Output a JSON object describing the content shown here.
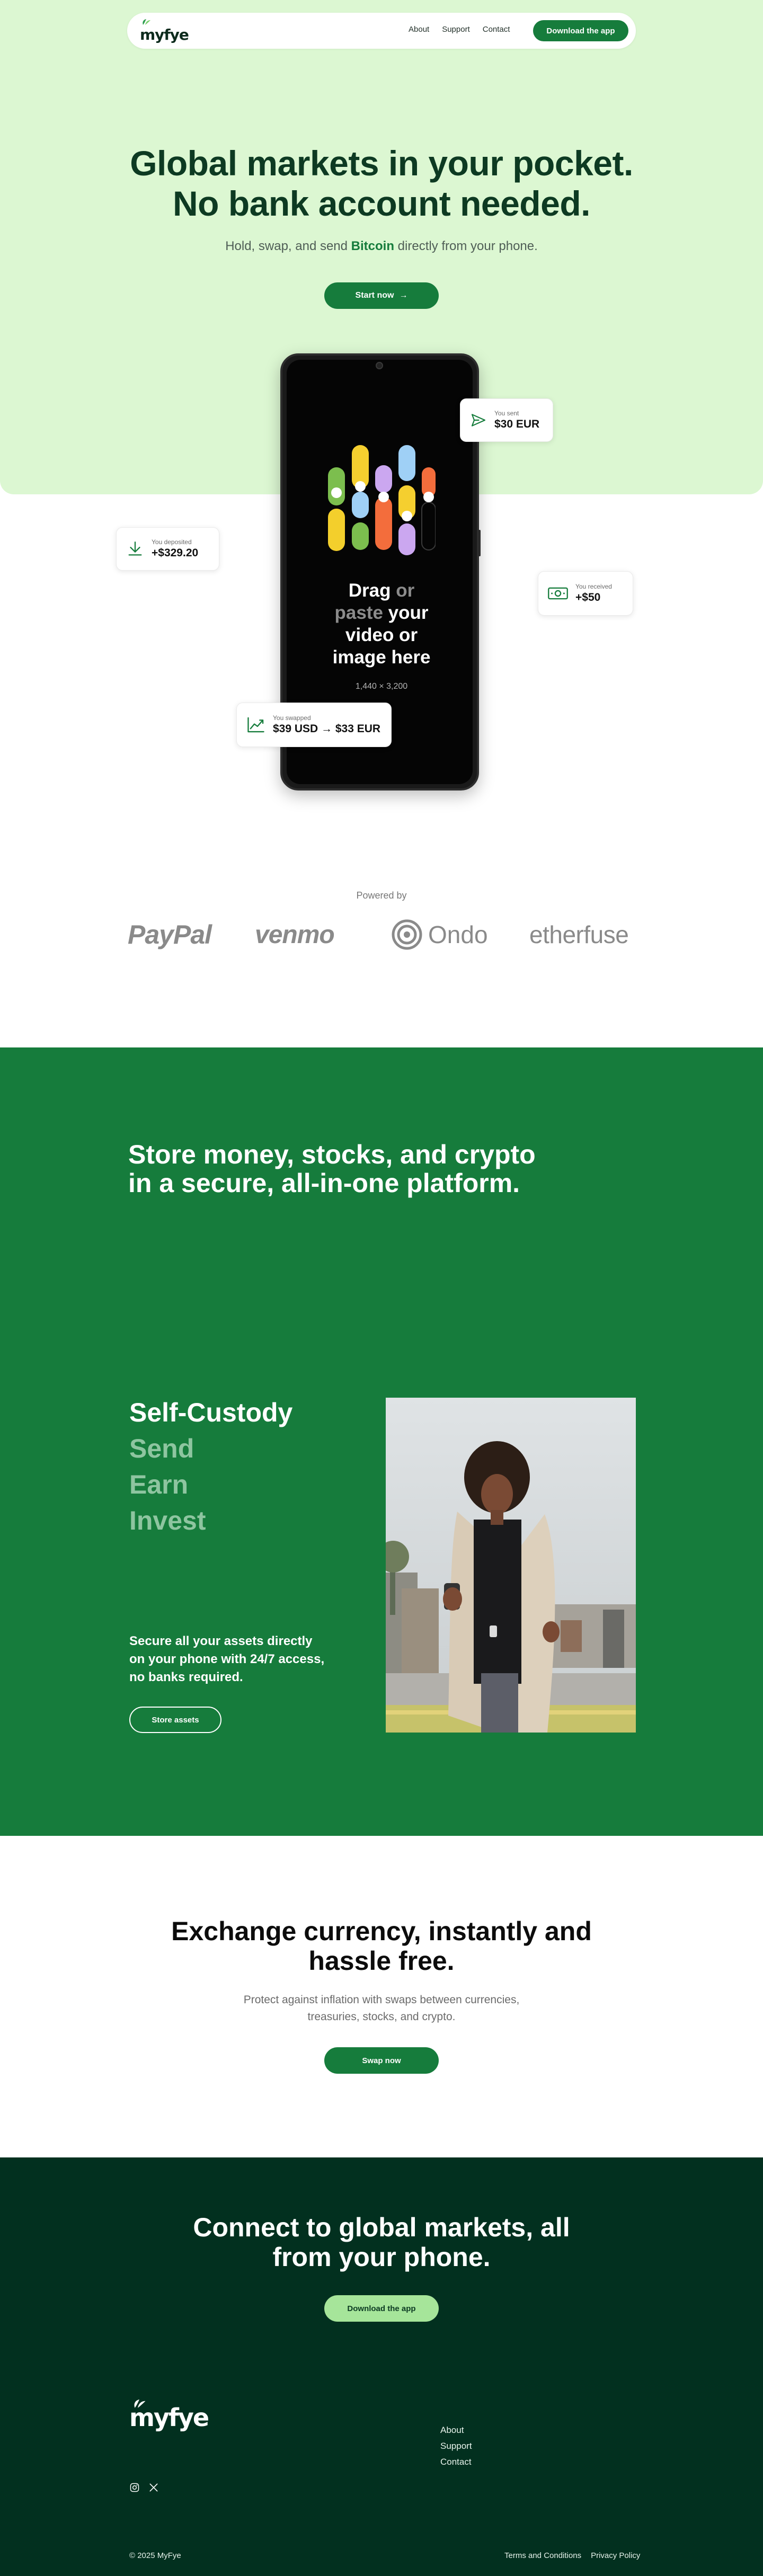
{
  "nav": {
    "logo": "myfye",
    "links": [
      "About",
      "Support",
      "Contact"
    ],
    "download_label": "Download the app"
  },
  "hero": {
    "title_line1": "Global markets in your pocket.",
    "title_line2": "No bank account needed.",
    "subtitle_pre": "Hold, swap, and send",
    "subtitle_highlight": "Bitcoin",
    "subtitle_post": "directly from your phone.",
    "cta_label": "Start now",
    "cta_arrow": "→"
  },
  "phone": {
    "drop_line1_a": "Drag",
    "drop_line1_b": "or",
    "drop_line2_a": "paste",
    "drop_line2_b": "your",
    "drop_line3": "video or",
    "drop_line4": "image here",
    "dimensions": "1,440 × 3,200"
  },
  "cards": {
    "sent": {
      "label": "You sent",
      "value": "$30 EUR",
      "icon": "send-icon"
    },
    "deposited": {
      "label": "You deposited",
      "value": "+$329.20",
      "icon": "download-icon"
    },
    "received": {
      "label": "You received",
      "value": "+$50",
      "icon": "banknote-icon"
    },
    "swapped": {
      "label": "You swapped",
      "value": "$39 USD → $33 EUR",
      "icon": "trend-up-icon"
    }
  },
  "powered": {
    "label": "Powered by",
    "brands": [
      "PayPal",
      "venmo",
      "Ondo",
      "etherfuse"
    ]
  },
  "platform": {
    "title_line1": "Store money, stocks, and crypto",
    "title_line2": "in a secure, all-in-one platform.",
    "features": [
      "Self-Custody",
      "Send",
      "Earn",
      "Invest"
    ],
    "active_feature": "Self-Custody",
    "description": "Secure all your assets directly on your phone with 24/7 access, no banks required.",
    "cta_label": "Store assets"
  },
  "exchange": {
    "title_line1": "Exchange currency, instantly and",
    "title_line2": "hassle free.",
    "subtitle_line1": "Protect against inflation with swaps between currencies,",
    "subtitle_line2": "treasuries, stocks, and crypto.",
    "cta_label": "Swap now"
  },
  "cta": {
    "title_line1": "Connect to global markets, all",
    "title_line2": "from your phone.",
    "button_label": "Download the app"
  },
  "footer": {
    "logo": "myfye",
    "links": [
      "About",
      "Support",
      "Contact"
    ],
    "social_icons": [
      "instagram-icon",
      "x-icon"
    ],
    "copyright": "© 2025 MyFye",
    "legal": [
      "Terms and Conditions",
      "Privacy Policy"
    ]
  },
  "colors": {
    "brand_green": "#167c3c",
    "hero_bg": "#dcf7d2",
    "dark_green": "#02301f",
    "light_green_button": "#a6e59a"
  }
}
